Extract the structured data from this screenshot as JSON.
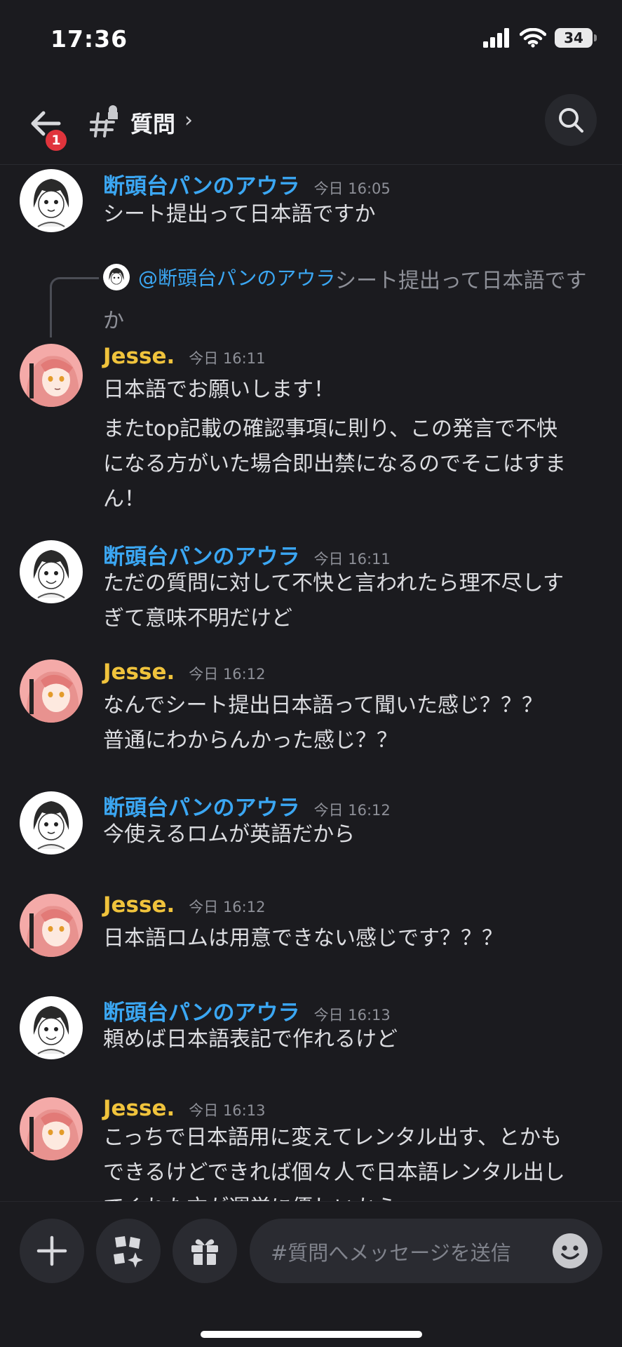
{
  "status_bar": {
    "time": "17:36",
    "battery": "34"
  },
  "header": {
    "channel_name": "質問",
    "chevron": "›",
    "unread_badge": "1"
  },
  "messages": [
    {
      "author": "断頭台パンのアウラ",
      "time": "今日 16:05",
      "lines": [
        "シート提出って日本語ですか"
      ]
    },
    {
      "author": "Jesse.",
      "time": "今日 16:11",
      "reply": {
        "mention": "@断頭台パンのアウラ",
        "text_line1": "シート提出って日本語です",
        "text_line2": "か"
      },
      "lines": [
        "日本語でお願いします！",
        "またtop記載の確認事項に則り、この発言で不快",
        "になる方がいた場合即出禁になるのでそこはすま",
        "ん！"
      ]
    },
    {
      "author": "断頭台パンのアウラ",
      "time": "今日 16:11",
      "lines": [
        "ただの質問に対して不快と言われたら理不尽しす",
        "ぎて意味不明だけど"
      ]
    },
    {
      "author": "Jesse.",
      "time": "今日 16:12",
      "lines": [
        "なんでシート提出日本語って聞いた感じ？？？",
        "普通にわからんかった感じ？？"
      ]
    },
    {
      "author": "断頭台パンのアウラ",
      "time": "今日 16:12",
      "lines": [
        "今使えるロムが英語だから"
      ]
    },
    {
      "author": "Jesse.",
      "time": "今日 16:12",
      "lines": [
        "日本語ロムは用意できない感じです？？？"
      ]
    },
    {
      "author": "断頭台パンのアウラ",
      "time": "今日 16:13",
      "lines": [
        "頼めば日本語表記で作れるけど"
      ]
    },
    {
      "author": "Jesse.",
      "time": "今日 16:13",
      "lines": [
        "こっちで日本語用に変えてレンタル出す、とかも",
        "できるけどできれば個々人で日本語レンタル出し",
        "てくれた方が運営に優しいから"
      ]
    }
  ],
  "composer": {
    "placeholder": "#質問へメッセージを送信"
  },
  "colors": {
    "background": "#1b1b1f",
    "aura_name": "#3ba7f3",
    "jesse_name": "#f0c33c",
    "badge": "#e0343c"
  }
}
